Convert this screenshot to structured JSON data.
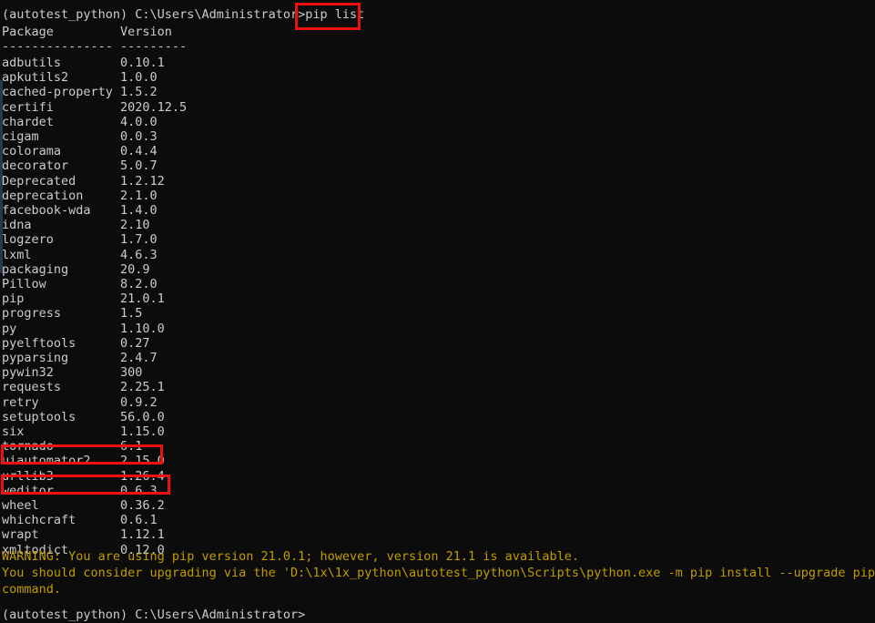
{
  "terminal": {
    "background_color": "#0c0c0c",
    "text_color": "#cccccc",
    "warning_color": "#c19c00",
    "highlight_color": "#ee1111",
    "prompt_top": "(autotest_python) C:\\Users\\Administrator>",
    "command": "pip list",
    "prompt_bottom": "(autotest_python) C:\\Users\\Administrator>"
  },
  "table": {
    "header_package": "Package",
    "header_version": "Version",
    "separator_package": "---------------",
    "separator_version": "---------",
    "rows": [
      {
        "name": "adbutils",
        "version": "0.10.1"
      },
      {
        "name": "apkutils2",
        "version": "1.0.0"
      },
      {
        "name": "cached-property",
        "version": "1.5.2"
      },
      {
        "name": "certifi",
        "version": "2020.12.5"
      },
      {
        "name": "chardet",
        "version": "4.0.0"
      },
      {
        "name": "cigam",
        "version": "0.0.3"
      },
      {
        "name": "colorama",
        "version": "0.4.4"
      },
      {
        "name": "decorator",
        "version": "5.0.7"
      },
      {
        "name": "Deprecated",
        "version": "1.2.12"
      },
      {
        "name": "deprecation",
        "version": "2.1.0"
      },
      {
        "name": "facebook-wda",
        "version": "1.4.0"
      },
      {
        "name": "idna",
        "version": "2.10"
      },
      {
        "name": "logzero",
        "version": "1.7.0"
      },
      {
        "name": "lxml",
        "version": "4.6.3"
      },
      {
        "name": "packaging",
        "version": "20.9"
      },
      {
        "name": "Pillow",
        "version": "8.2.0"
      },
      {
        "name": "pip",
        "version": "21.0.1"
      },
      {
        "name": "progress",
        "version": "1.5"
      },
      {
        "name": "py",
        "version": "1.10.0"
      },
      {
        "name": "pyelftools",
        "version": "0.27"
      },
      {
        "name": "pyparsing",
        "version": "2.4.7"
      },
      {
        "name": "pywin32",
        "version": "300"
      },
      {
        "name": "requests",
        "version": "2.25.1"
      },
      {
        "name": "retry",
        "version": "0.9.2"
      },
      {
        "name": "setuptools",
        "version": "56.0.0"
      },
      {
        "name": "six",
        "version": "1.15.0"
      },
      {
        "name": "tornado",
        "version": "6.1"
      },
      {
        "name": "uiautomator2",
        "version": "2.15.0"
      },
      {
        "name": "urllib3",
        "version": "1.26.4"
      },
      {
        "name": "weditor",
        "version": "0.6.3"
      },
      {
        "name": "wheel",
        "version": "0.36.2"
      },
      {
        "name": "whichcraft",
        "version": "0.6.1"
      },
      {
        "name": "wrapt",
        "version": "1.12.1"
      },
      {
        "name": "xmltodict",
        "version": "0.12.0"
      }
    ]
  },
  "warning": {
    "line1": "WARNING: You are using pip version 21.0.1; however, version 21.1 is available.",
    "line2": "You should consider upgrading via the 'D:\\1x\\1x_python\\autotest_python\\Scripts\\python.exe -m pip install --upgrade pip'",
    "line3": "command."
  },
  "annotations": {
    "box_command": "pip list",
    "box_uiautomator2": "uiautomator2 2.15.0",
    "box_weditor": "weditor 0.6.3"
  }
}
